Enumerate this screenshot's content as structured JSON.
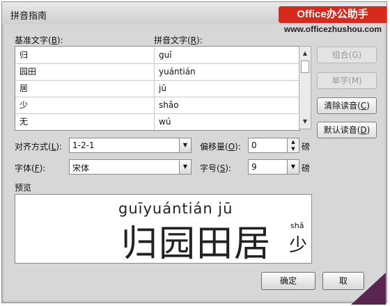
{
  "dialog": {
    "title": "拼音指南",
    "brand_text": "Office办公助手",
    "brand_url": "www.officezhushou.com"
  },
  "labels": {
    "base_text": "基准文字(",
    "base_key": "B",
    "base_tail": "):",
    "pinyin_text": "拼音文字(",
    "pinyin_key": "R",
    "pinyin_tail": "):"
  },
  "rows": [
    {
      "base": "归",
      "pinyin": "guī"
    },
    {
      "base": "园田",
      "pinyin": "yuántián"
    },
    {
      "base": "居",
      "pinyin": "jū"
    },
    {
      "base": "少",
      "pinyin": "shǎo"
    },
    {
      "base": "无",
      "pinyin": "wú"
    }
  ],
  "buttons": {
    "combine": "组合(G)",
    "single": "单字(M)",
    "clear_pre": "清除读音(",
    "clear_key": "C",
    "clear_post": ")",
    "default_pre": "默认读音(",
    "default_key": "D",
    "default_post": ")",
    "ok": "确定",
    "cancel": "取"
  },
  "options": {
    "align_pre": "对齐方式(",
    "align_key": "L",
    "align_post": "):",
    "align_value": "1-2-1",
    "offset_pre": "偏移量(",
    "offset_key": "O",
    "offset_post": "):",
    "offset_value": "0",
    "offset_unit": "磅",
    "font_pre": "字体(",
    "font_key": "F",
    "font_post": "):",
    "font_value": "宋体",
    "size_pre": "字号(",
    "size_key": "S",
    "size_post": "):",
    "size_value": "9",
    "size_unit": "磅"
  },
  "preview": {
    "label": "预览",
    "pinyin": "guīyuántián jū",
    "chars": "归园田居",
    "small_pinyin": "shǎ",
    "small_char": "少"
  },
  "icons": {
    "dropdown": "chevron-down-icon",
    "spin_up": "caret-up-icon",
    "spin_down": "caret-down-icon",
    "scroll_up": "caret-up-icon",
    "scroll_down": "caret-down-icon"
  },
  "colors": {
    "brand_red": "#d62b1c",
    "dialog_bg": "#d7d7d7",
    "curl": "#5a2550"
  }
}
